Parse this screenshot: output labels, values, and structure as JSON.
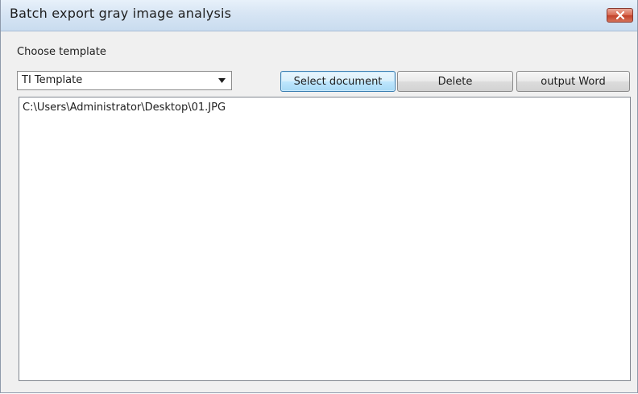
{
  "window": {
    "title": "Batch export gray image analysis",
    "close_icon": "close-icon",
    "close_color": "#c9462f"
  },
  "template": {
    "label": "Choose template",
    "selected": "TI Template",
    "dropdown_icon": "dropdown-arrow-icon"
  },
  "buttons": {
    "select_document": "Select document",
    "delete": "Delete",
    "output_word": "output Word"
  },
  "documents": [
    "C:\\Users\\Administrator\\Desktop\\01.JPG"
  ]
}
